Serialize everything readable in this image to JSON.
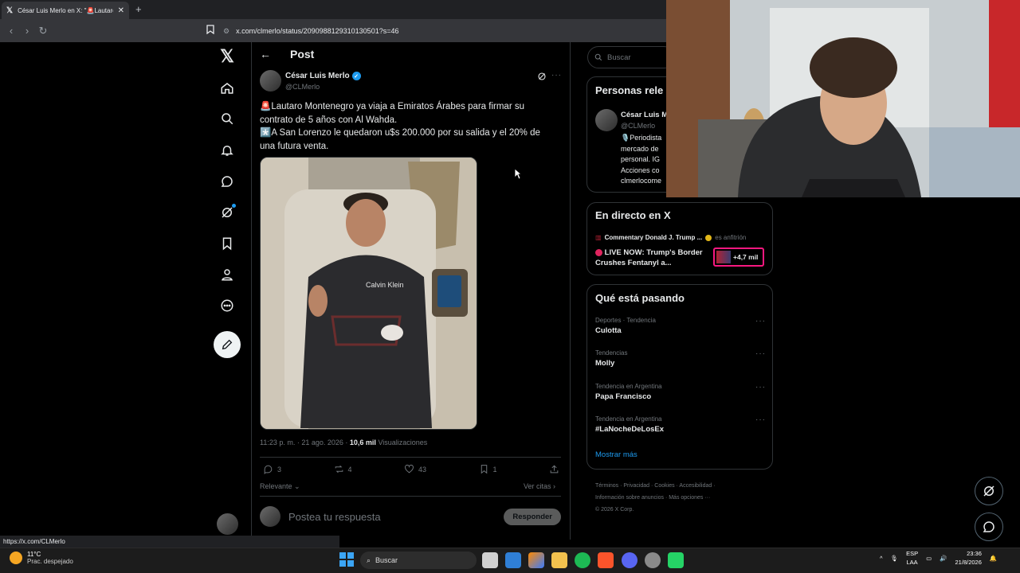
{
  "browser": {
    "tab_title": "César Luis Merlo en X: \"🚨Lautaro",
    "address": "x.com/clmerlo/status/2090988129310130501?s=46"
  },
  "post_header": {
    "title": "Post"
  },
  "post": {
    "author_name": "César Luis Merlo",
    "author_handle": "@CLMerlo",
    "line1": "🚨Lautaro Montenegro ya viaja a Emiratos Árabes para firmar su contrato de 5 años con Al Wahda.",
    "line2": "*️⃣A San Lorenzo le quedaron u$s 200.000 por su salida y el 20% de una futura venta.",
    "timestamp": "11:23 p. m. · 21 ago. 2026 · ",
    "views_count": "10,6 mil",
    "views_label": " Visualizaciones",
    "replies": "3",
    "reposts": "4",
    "likes": "43",
    "bookmarks": "1",
    "sort_label": "Relevante",
    "quotes_label": "Ver citas",
    "reply_placeholder": "Postea tu respuesta",
    "reply_button": "Responder",
    "image_text": "Calvin Klein"
  },
  "search": {
    "placeholder": "Buscar"
  },
  "relevant": {
    "title": "Personas rele",
    "name": "César Luis M",
    "handle": "@CLMerlo",
    "bio": [
      "🎙️Periodista",
      "mercado de",
      "personal. IG",
      "Acciones co",
      "clmerlocome"
    ]
  },
  "live": {
    "title": "En directo en X",
    "host": "Commentary Donald J. Trump ...",
    "host_role": "es anfitrión",
    "stream_title": "LIVE NOW: Trump's Border Crushes Fentanyl a...",
    "listeners": "+4,7 mil"
  },
  "trends": {
    "title": "Qué está pasando",
    "items": [
      {
        "category": "Deportes · Tendencia",
        "name": "Culotta"
      },
      {
        "category": "Tendencias",
        "name": "Molly"
      },
      {
        "category": "Tendencia en Argentina",
        "name": "Papa Francisco"
      },
      {
        "category": "Tendencia en Argentina",
        "name": "#LaNocheDeLosEx"
      }
    ],
    "more": "Mostrar más"
  },
  "footer": {
    "line1": "Términos  ·  Privacidad  ·  Cookies  ·  Accesibilidad  ·",
    "line2": "Información sobre anuncios  ·  Más opciones ···",
    "line3": "© 2026 X Corp."
  },
  "status_link": "https://x.com/CLMerlo",
  "taskbar": {
    "temp": "11°C",
    "condition": "Prac. despejado",
    "search": "Buscar",
    "lang1": "ESP",
    "lang2": "LAA",
    "time": "23:36",
    "date": "21/8/2026"
  },
  "colors": {
    "accent": "#1d9bf0",
    "background": "#000000",
    "live_border": "#f91880"
  }
}
